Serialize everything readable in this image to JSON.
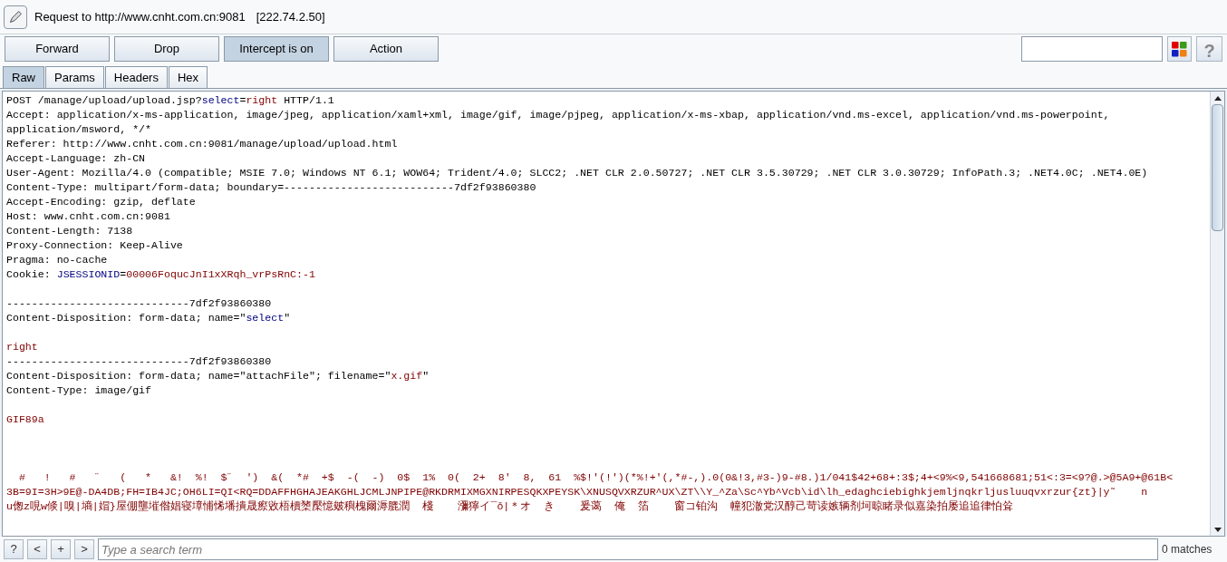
{
  "window": {
    "title": "Request to http://www.cnht.com.cn:9081",
    "address": "[222.74.2.50]"
  },
  "buttons": [
    {
      "label": "Forward",
      "pressed": false
    },
    {
      "label": "Drop",
      "pressed": false
    },
    {
      "label": "Intercept is on",
      "pressed": true
    },
    {
      "label": "Action",
      "pressed": false
    }
  ],
  "tabs": [
    {
      "label": "Raw",
      "selected": true
    },
    {
      "label": "Params",
      "selected": false
    },
    {
      "label": "Headers",
      "selected": false
    },
    {
      "label": "Hex",
      "selected": false
    }
  ],
  "message_lines": [
    {
      "kind": "text",
      "segments": [
        {
          "text": "POST /manage/upload/upload.jsp?",
          "kind": "plain"
        },
        {
          "text": "select",
          "kind": "param"
        },
        {
          "text": "=",
          "kind": "plain"
        },
        {
          "text": "right",
          "kind": "value"
        },
        {
          "text": " HTTP/1.1",
          "kind": "plain"
        }
      ]
    },
    {
      "kind": "text",
      "segments": [
        {
          "text": "Accept: application/x-ms-application, image/jpeg, application/xaml+xml, image/gif, image/pjpeg, application/x-ms-xbap, application/vnd.ms-excel, application/vnd.ms-powerpoint,",
          "kind": "plain"
        }
      ]
    },
    {
      "kind": "text",
      "segments": [
        {
          "text": "application/msword, */*",
          "kind": "plain"
        }
      ]
    },
    {
      "kind": "text",
      "segments": [
        {
          "text": "Referer: http://www.cnht.com.cn:9081/manage/upload/upload.html",
          "kind": "plain"
        }
      ]
    },
    {
      "kind": "text",
      "segments": [
        {
          "text": "Accept-Language: zh-CN",
          "kind": "plain"
        }
      ]
    },
    {
      "kind": "text",
      "segments": [
        {
          "text": "User-Agent: Mozilla/4.0 (compatible; MSIE 7.0; Windows NT 6.1; WOW64; Trident/4.0; SLCC2; .NET CLR 2.0.50727; .NET CLR 3.5.30729; .NET CLR 3.0.30729; InfoPath.3; .NET4.0C; .NET4.0E)",
          "kind": "plain"
        }
      ]
    },
    {
      "kind": "text",
      "segments": [
        {
          "text": "Content-Type: multipart/form-data; boundary=---------------------------7df2f93860380",
          "kind": "plain"
        }
      ]
    },
    {
      "kind": "text",
      "segments": [
        {
          "text": "Accept-Encoding: gzip, deflate",
          "kind": "plain"
        }
      ]
    },
    {
      "kind": "text",
      "segments": [
        {
          "text": "Host: www.cnht.com.cn:9081",
          "kind": "plain"
        }
      ]
    },
    {
      "kind": "text",
      "segments": [
        {
          "text": "Content-Length: 7138",
          "kind": "plain"
        }
      ]
    },
    {
      "kind": "text",
      "segments": [
        {
          "text": "Proxy-Connection: Keep-Alive",
          "kind": "plain"
        }
      ]
    },
    {
      "kind": "text",
      "segments": [
        {
          "text": "Pragma: no-cache",
          "kind": "plain"
        }
      ]
    },
    {
      "kind": "text",
      "segments": [
        {
          "text": "Cookie: ",
          "kind": "plain"
        },
        {
          "text": "JSESSIONID",
          "kind": "param"
        },
        {
          "text": "=",
          "kind": "plain"
        },
        {
          "text": "00006FoqucJnI1xXRqh_vrPsRnC:-1",
          "kind": "value"
        }
      ]
    },
    {
      "kind": "blank"
    },
    {
      "kind": "text",
      "segments": [
        {
          "text": "-----------------------------7df2f93860380",
          "kind": "plain"
        }
      ]
    },
    {
      "kind": "text",
      "segments": [
        {
          "text": "Content-Disposition: form-data; name=\"",
          "kind": "plain"
        },
        {
          "text": "select",
          "kind": "param"
        },
        {
          "text": "\"",
          "kind": "plain"
        }
      ]
    },
    {
      "kind": "blank"
    },
    {
      "kind": "text",
      "segments": [
        {
          "text": "right",
          "kind": "value"
        }
      ]
    },
    {
      "kind": "text",
      "segments": [
        {
          "text": "-----------------------------7df2f93860380",
          "kind": "plain"
        }
      ]
    },
    {
      "kind": "text",
      "segments": [
        {
          "text": "Content-Disposition: form-data; name=\"attachFile\"; filename=\"",
          "kind": "plain"
        },
        {
          "text": "x.gif",
          "kind": "value"
        },
        {
          "text": "\"",
          "kind": "plain"
        }
      ]
    },
    {
      "kind": "text",
      "segments": [
        {
          "text": "Content-Type: image/gif",
          "kind": "plain"
        }
      ]
    },
    {
      "kind": "blank"
    },
    {
      "kind": "text",
      "segments": [
        {
          "text": "GIF89a",
          "kind": "value"
        }
      ]
    },
    {
      "kind": "blank"
    },
    {
      "kind": "blank"
    },
    {
      "kind": "blank"
    },
    {
      "kind": "text",
      "segments": [
        {
          "text": "  #   !   #   ˝   (   *   &!  %!  $˝  ')  &(  *#  +$  -(  -)  0$  1%  0(  2+  8'  8,  61  %$!'(!')(*%!+'(,*#-,).0(0&!3,#3-)9-#8.)1/041$42+68+:3$;4+<9%<9,541668681;51<:3=<9?@.>@5A9+@61B<",
          "kind": "value"
        }
      ]
    },
    {
      "kind": "text",
      "segments": [
        {
          "text": "3B=9I=3H>9E@-DA4DB;FH=IB4JC;OH6LI=QI<RQ=DDAFFHGHAJEAKGHLJCMLJNPIPE@RKDRMIXMGXNIRPESQKXPEYSK\\XNUSQVXRZUR^UX\\ZT\\\\Y_^Za\\Sc^Yb^Vcb\\id\\lh_edaghciebighkjemljnqkrljusluuqvxrzur{zt}|y˜    n",
          "kind": "value"
        }
      ]
    },
    {
      "kind": "text",
      "segments": [
        {
          "text": "u偬z哯w倐|嗅|墒|媢}屋倗壟墔偺娼寝墇悑悕墦撌晟瘵敓梧檟橥檿憶皴穥槐爾溽膍潤  棧    瀰獰イ¯ǒ|＊オ  き    爰蔼  俺  箔    窗コ铂沟  幢犯澈党汉醇己苛读嫉辆剂坷晾睹录似嘉染拍屡追追律怕耸",
          "kind": "value"
        }
      ]
    }
  ],
  "search": {
    "placeholder": "Type a search term",
    "result": "0 matches"
  },
  "search_nav": [
    "?",
    "<",
    "+",
    ">"
  ],
  "help_button": "?"
}
